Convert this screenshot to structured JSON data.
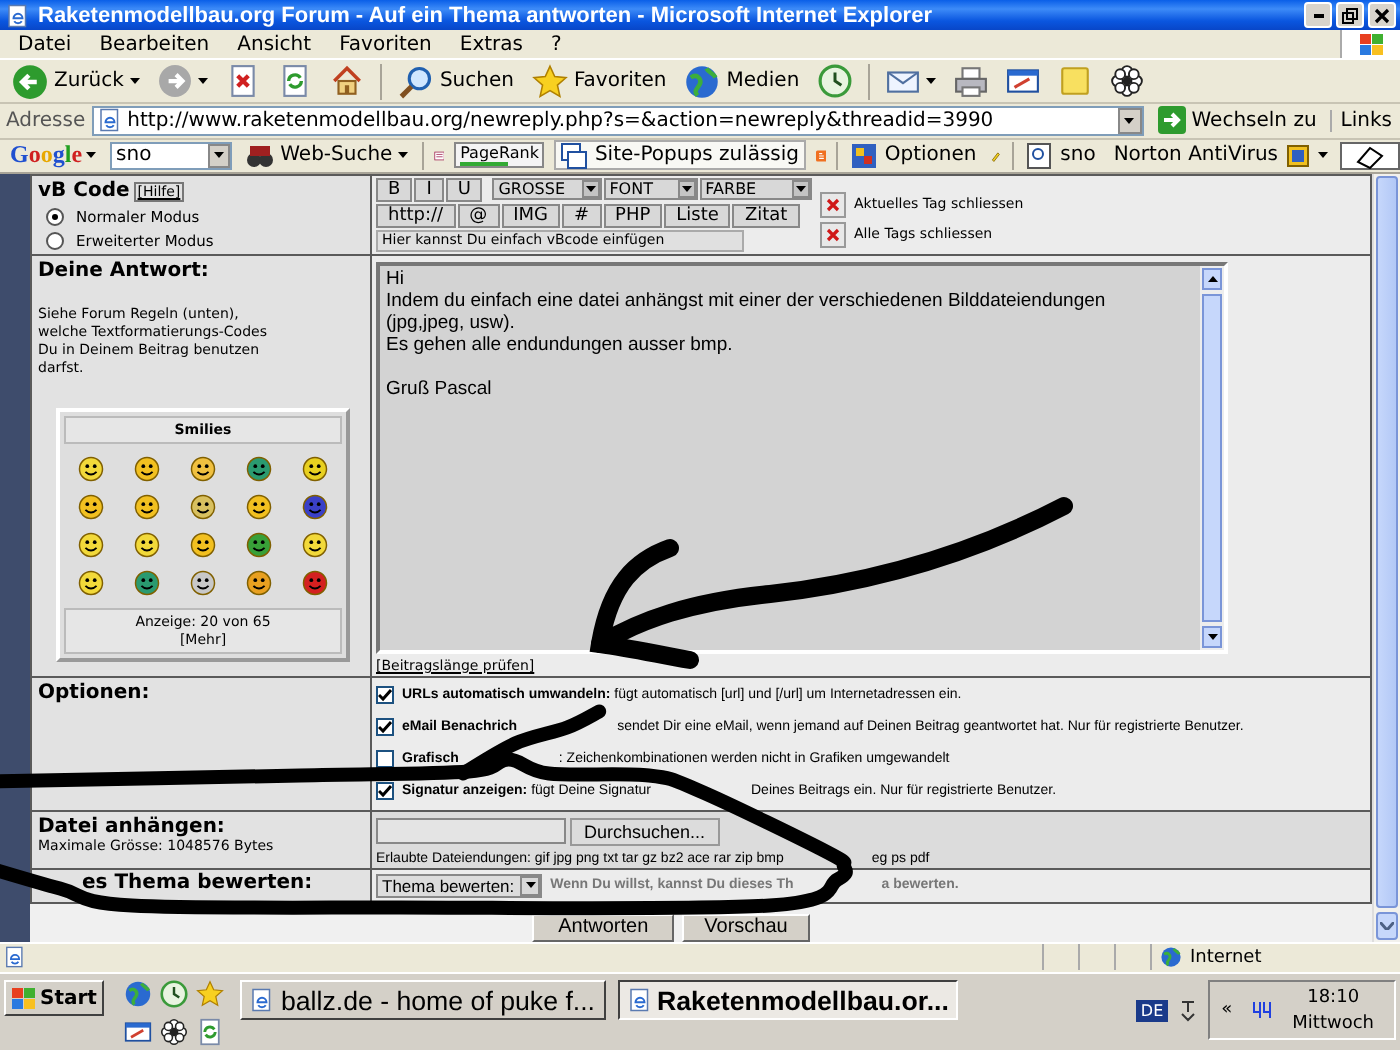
{
  "window": {
    "title": "Raketenmodellbau.org Forum - Auf ein Thema antworten - Microsoft Internet Explorer"
  },
  "menu": [
    "Datei",
    "Bearbeiten",
    "Ansicht",
    "Favoriten",
    "Extras",
    "?"
  ],
  "toolbar": [
    {
      "kind": "back",
      "label": "Zurück",
      "dropdown": true
    },
    {
      "kind": "forward",
      "dropdown": true
    },
    {
      "kind": "stop",
      "dropdown": false
    },
    {
      "kind": "refresh",
      "dropdown": false
    },
    {
      "kind": "home",
      "dropdown": false
    },
    {
      "kind": "separator"
    },
    {
      "kind": "search",
      "label": "Suchen",
      "dropdown": false
    },
    {
      "kind": "favorites",
      "label": "Favoriten",
      "dropdown": false
    },
    {
      "kind": "media",
      "label": "Medien",
      "dropdown": false
    },
    {
      "kind": "history",
      "dropdown": false
    },
    {
      "kind": "separator"
    },
    {
      "kind": "mail",
      "dropdown": true
    },
    {
      "kind": "print",
      "dropdown": false
    },
    {
      "kind": "edit",
      "dropdown": false
    },
    {
      "kind": "note",
      "dropdown": false
    },
    {
      "kind": "flower",
      "dropdown": false
    }
  ],
  "address": {
    "label": "Adresse",
    "url": "http://www.raketenmodellbau.org/newreply.php?s=&action=newreply&threadid=3990",
    "go": "Wechseln zu",
    "links": "Links"
  },
  "google_bar": {
    "logo": "Google",
    "query": "sno",
    "search": "Web-Suche",
    "pagerank": "PageRank",
    "popups": "Site-Popups zulässig",
    "options": "Optionen",
    "query_button": "sno",
    "antivirus": "Norton AntiVirus"
  },
  "form": {
    "vbcode": {
      "title": "vB Code",
      "help": "[Hilfe]",
      "modes": [
        {
          "label": "Normaler Modus",
          "selected": true
        },
        {
          "label": "Erweiterter Modus",
          "selected": false
        }
      ],
      "format_buttons": [
        "B",
        "I",
        "U"
      ],
      "selects": [
        "GROSSE",
        "FONT",
        "FARBE"
      ],
      "tag_buttons": [
        "http://",
        "@",
        "IMG",
        "#",
        "PHP",
        "Liste",
        "Zitat"
      ],
      "hint": "Hier kannst Du einfach vBcode einfügen",
      "close_actions": [
        "Aktuelles Tag schliessen",
        "Alle Tags schliessen"
      ]
    },
    "reply": {
      "title": "Deine Antwort:",
      "help": "Siehe Forum Regeln (unten), welche Textformatierungs-Codes Du in Deinem Beitrag benutzen darfst.",
      "smilies": {
        "title": "Smilies",
        "count": "Anzeige: 20 von 65",
        "more": "[Mehr]"
      },
      "message": "Hi\nIndem du einfach eine datei anhängst mit einer der verschiedenen Bilddateiendungen (jpg,jpeg, usw).\nEs gehen alle endundungen ausser bmp.\n\nGruß Pascal",
      "check_length": "[Beitragslänge prüfen]"
    },
    "options": {
      "title": "Optionen:",
      "items": [
        {
          "checked": true,
          "segments": [
            {
              "text": "**URLs automatisch umwandeln:** fügt automatisch [url] und [/url] um Internetadressen ein.",
              "bold": false
            }
          ]
        },
        {
          "checked": true,
          "segments": [
            {
              "text": "eMail Benachrich",
              "bold": true
            },
            {
              "text": "sendet Dir eine eMail, wenn jemand auf Deinen Beitrag geantwortet hat. Nur für registrierte Benutzer.",
              "bold": false
            }
          ]
        },
        {
          "checked": false,
          "segments": [
            {
              "text": "Grafisch",
              "bold": true
            },
            {
              "text": ": Zeichenkombinationen werden nicht in Grafiken umgewandelt",
              "bold": false
            }
          ]
        },
        {
          "checked": true,
          "segments": [
            {
              "text": "**Signatur anzeigen:** fügt Deine Signatur",
              "bold": false
            },
            {
              "text": "Deines Beitrags ein. Nur für registrierte Benutzer.",
              "bold": false
            }
          ]
        }
      ]
    },
    "attachment": {
      "title": "Datei anhängen:",
      "max_size": "Maximale Grösse: 1048576 Bytes",
      "browse": "Durchsuchen...",
      "allowed": [
        "Erlaubte Dateiendungen: gif jpg png txt tar gz bz2 ace rar zip bmp",
        "eg ps pdf"
      ]
    },
    "rating": {
      "title": "es Thema bewerten:",
      "select": "Thema bewerten:",
      "hint": [
        "Wenn Du willst, kannst Du dieses Th",
        "a bewerten."
      ]
    },
    "buttons": [
      "Antworten",
      "Vorschau"
    ]
  },
  "status_bar": {
    "zone": "Internet"
  },
  "taskbar": {
    "start": "Start",
    "tasks": [
      {
        "label": "ballz.de - home of puke f...",
        "selected": false
      },
      {
        "label": "Raketenmodellbau.or...",
        "selected": true
      }
    ],
    "language": "DE",
    "expand": "«",
    "time": "18:10",
    "day": "Mittwoch"
  }
}
